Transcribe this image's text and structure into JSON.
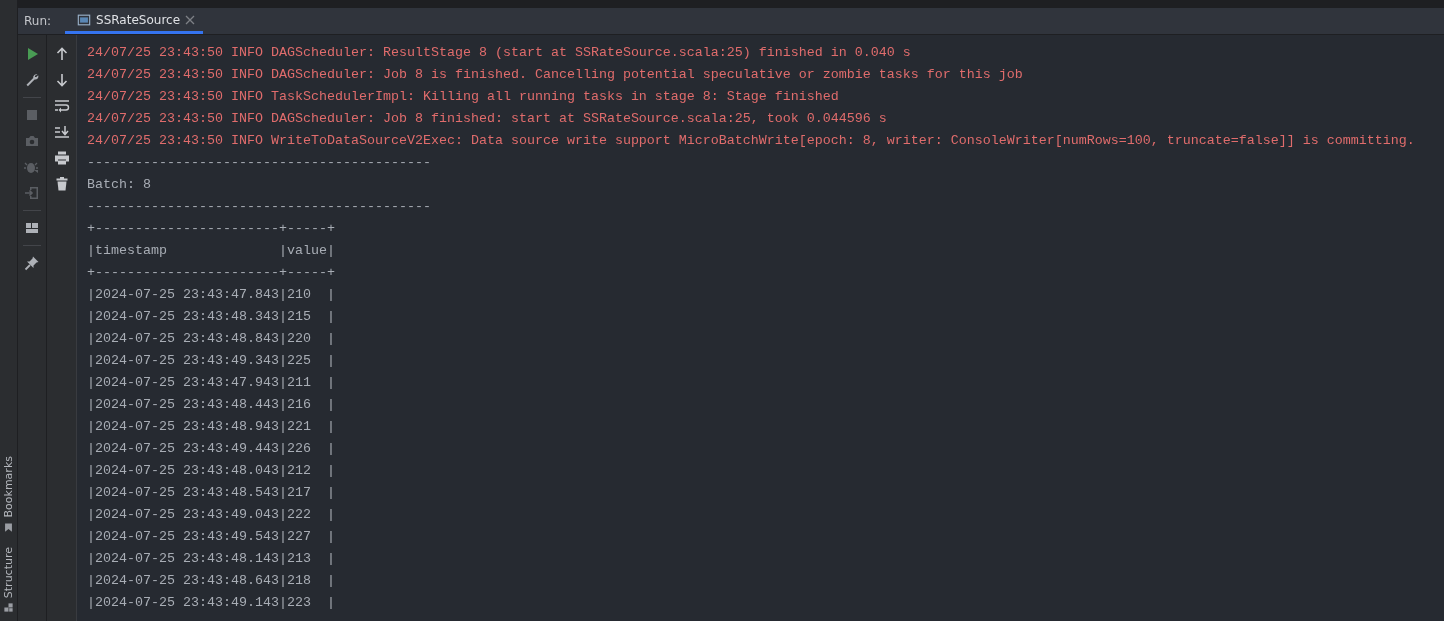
{
  "side_stripe": [
    {
      "label": "Bookmarks",
      "kind": "bookmark"
    },
    {
      "label": "Structure",
      "kind": "structure"
    }
  ],
  "run_panel": {
    "label": "Run:",
    "tabs": [
      {
        "label": "SSRateSource",
        "selected": true
      }
    ]
  },
  "left_toolbar": [
    {
      "kind": "run",
      "disabled": false
    },
    {
      "kind": "wrench",
      "disabled": false
    },
    {
      "kind": "divider"
    },
    {
      "kind": "stop",
      "disabled": true
    },
    {
      "kind": "camera",
      "disabled": true
    },
    {
      "kind": "bug",
      "disabled": true
    },
    {
      "kind": "exit",
      "disabled": true
    },
    {
      "kind": "divider"
    },
    {
      "kind": "layout",
      "disabled": false
    },
    {
      "kind": "divider"
    },
    {
      "kind": "pin",
      "disabled": false
    }
  ],
  "console_toolbar": [
    {
      "kind": "up"
    },
    {
      "kind": "down"
    },
    {
      "kind": "wrap"
    },
    {
      "kind": "scroll-end"
    },
    {
      "kind": "print"
    },
    {
      "kind": "trash"
    }
  ],
  "console_lines": [
    {
      "kind": "log",
      "text": "24/07/25 23:43:50 INFO DAGScheduler: ResultStage 8 (start at SSRateSource.scala:25) finished in 0.040 s"
    },
    {
      "kind": "log",
      "text": "24/07/25 23:43:50 INFO DAGScheduler: Job 8 is finished. Cancelling potential speculative or zombie tasks for this job"
    },
    {
      "kind": "log",
      "text": "24/07/25 23:43:50 INFO TaskSchedulerImpl: Killing all running tasks in stage 8: Stage finished"
    },
    {
      "kind": "log",
      "text": "24/07/25 23:43:50 INFO DAGScheduler: Job 8 finished: start at SSRateSource.scala:25, took 0.044596 s"
    },
    {
      "kind": "log",
      "text": "24/07/25 23:43:50 INFO WriteToDataSourceV2Exec: Data source write support MicroBatchWrite[epoch: 8, writer: ConsoleWriter[numRows=100, truncate=false]] is committing."
    },
    {
      "kind": "output",
      "text": "-------------------------------------------"
    },
    {
      "kind": "output",
      "text": "Batch: 8"
    },
    {
      "kind": "output",
      "text": "-------------------------------------------"
    },
    {
      "kind": "output",
      "text": "+-----------------------+-----+"
    },
    {
      "kind": "output",
      "text": "|timestamp              |value|"
    },
    {
      "kind": "output",
      "text": "+-----------------------+-----+"
    },
    {
      "kind": "output",
      "text": "|2024-07-25 23:43:47.843|210  |"
    },
    {
      "kind": "output",
      "text": "|2024-07-25 23:43:48.343|215  |"
    },
    {
      "kind": "output",
      "text": "|2024-07-25 23:43:48.843|220  |"
    },
    {
      "kind": "output",
      "text": "|2024-07-25 23:43:49.343|225  |"
    },
    {
      "kind": "output",
      "text": "|2024-07-25 23:43:47.943|211  |"
    },
    {
      "kind": "output",
      "text": "|2024-07-25 23:43:48.443|216  |"
    },
    {
      "kind": "output",
      "text": "|2024-07-25 23:43:48.943|221  |"
    },
    {
      "kind": "output",
      "text": "|2024-07-25 23:43:49.443|226  |"
    },
    {
      "kind": "output",
      "text": "|2024-07-25 23:43:48.043|212  |"
    },
    {
      "kind": "output",
      "text": "|2024-07-25 23:43:48.543|217  |"
    },
    {
      "kind": "output",
      "text": "|2024-07-25 23:43:49.043|222  |"
    },
    {
      "kind": "output",
      "text": "|2024-07-25 23:43:49.543|227  |"
    },
    {
      "kind": "output",
      "text": "|2024-07-25 23:43:48.143|213  |"
    },
    {
      "kind": "output",
      "text": "|2024-07-25 23:43:48.643|218  |"
    },
    {
      "kind": "output",
      "text": "|2024-07-25 23:43:49.143|223  |"
    }
  ]
}
